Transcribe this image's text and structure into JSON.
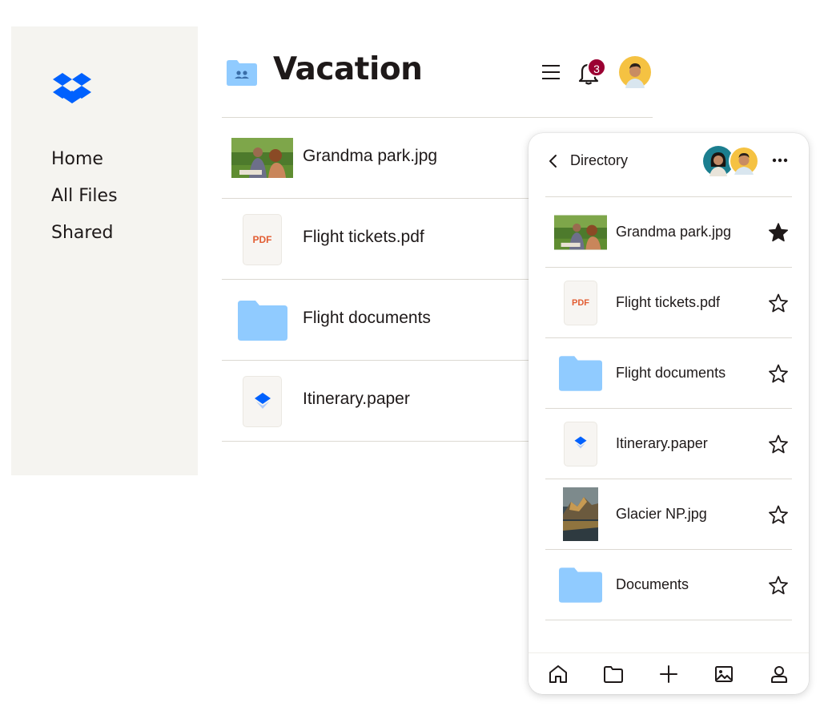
{
  "sidebar": {
    "logo_name": "dropbox-logo",
    "nav": [
      {
        "label": "Home"
      },
      {
        "label": "All Files"
      },
      {
        "label": "Shared"
      }
    ]
  },
  "header": {
    "title": "Vacation",
    "notification_count": "3"
  },
  "main_files": [
    {
      "name": "Grandma park.jpg",
      "kind": "image"
    },
    {
      "name": "Flight tickets.pdf",
      "kind": "pdf",
      "badge": "PDF"
    },
    {
      "name": "Flight documents",
      "kind": "folder"
    },
    {
      "name": "Itinerary.paper",
      "kind": "paper"
    }
  ],
  "panel": {
    "title": "Directory",
    "files": [
      {
        "name": "Grandma park.jpg",
        "kind": "image",
        "starred": true
      },
      {
        "name": "Flight tickets.pdf",
        "kind": "pdf",
        "badge": "PDF",
        "starred": false
      },
      {
        "name": "Flight documents",
        "kind": "folder",
        "starred": false
      },
      {
        "name": "Itinerary.paper",
        "kind": "paper",
        "starred": false
      },
      {
        "name": "Glacier NP.jpg",
        "kind": "image",
        "starred": false
      },
      {
        "name": "Documents",
        "kind": "folder",
        "starred": false
      }
    ],
    "tabs": [
      "home-icon",
      "folder-icon",
      "plus-icon",
      "photos-icon",
      "account-icon"
    ]
  },
  "colors": {
    "brand_blue": "#0061fe",
    "folder_blue": "#90cbff",
    "badge_red": "#9b0032",
    "pdf_orange": "#e25d33",
    "sidebar_bg": "#f5f4f0"
  }
}
